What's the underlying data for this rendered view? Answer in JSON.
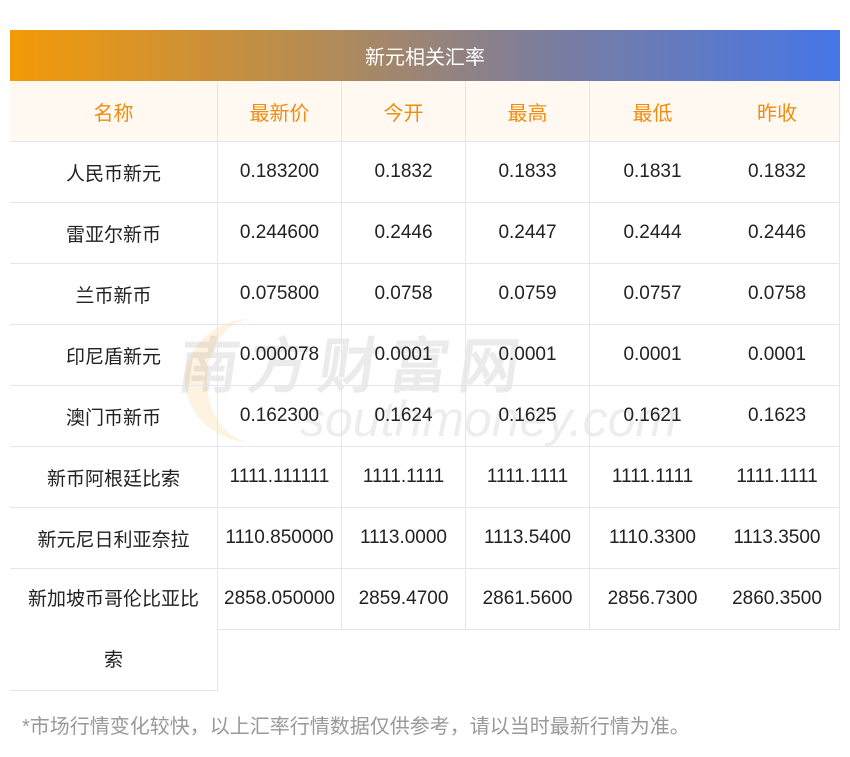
{
  "title": "新元相关汇率",
  "headers": [
    "名称",
    "最新价",
    "今开",
    "最高",
    "最低",
    "昨收"
  ],
  "rows": [
    [
      "人民币新元",
      "0.183200",
      "0.1832",
      "0.1833",
      "0.1831",
      "0.1832"
    ],
    [
      "雷亚尔新币",
      "0.244600",
      "0.2446",
      "0.2447",
      "0.2444",
      "0.2446"
    ],
    [
      "兰币新币",
      "0.075800",
      "0.0758",
      "0.0759",
      "0.0757",
      "0.0758"
    ],
    [
      "印尼盾新元",
      "0.000078",
      "0.0001",
      "0.0001",
      "0.0001",
      "0.0001"
    ],
    [
      "澳门币新币",
      "0.162300",
      "0.1624",
      "0.1625",
      "0.1621",
      "0.1623"
    ],
    [
      "新币阿根廷比索",
      "1111.111111",
      "1111.1111",
      "1111.1111",
      "1111.1111",
      "1111.1111"
    ],
    [
      "新元尼日利亚奈拉",
      "1110.850000",
      "1113.0000",
      "1113.5400",
      "1110.3300",
      "1113.3500"
    ],
    [
      "新加坡币哥伦比亚比索",
      "2858.050000",
      "2859.4700",
      "2861.5600",
      "2856.7300",
      "2860.3500"
    ]
  ],
  "last_name_lines": [
    "新加坡币哥伦比亚比",
    "索"
  ],
  "watermark": {
    "cn": "南方财富网",
    "en": "southmoney.com"
  },
  "note": "*市场行情变化较快，以上汇率行情数据仅供参考，请以当时最新行情为准。"
}
